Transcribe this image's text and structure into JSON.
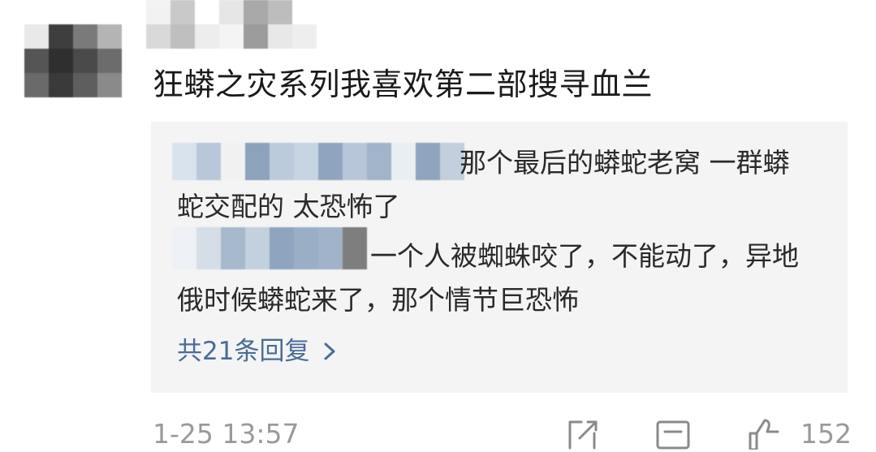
{
  "comment": {
    "text": "狂蟒之灾系列我喜欢第二部搜寻血兰"
  },
  "replies": [
    {
      "line1": "那个最后的蟒蛇老窝  一群蟒",
      "line2": "蛇交配的  太恐怖了"
    },
    {
      "line1": "一个人被蜘蛛咬了，不能动了，异地",
      "line2": "俄时候蟒蛇来了，那个情节巨恐怖"
    }
  ],
  "reply_count_label": "共21条回复",
  "footer": {
    "timestamp": "1-25 13:57",
    "like_count": "152",
    "icons": [
      "share-icon",
      "comment-icon",
      "like-icon"
    ]
  },
  "colors": {
    "link": "#4a6c96",
    "reply_bg": "#f4f4f4",
    "meta": "#9a9a9a"
  },
  "avatar_mosaic": [
    "#e9e9e9",
    "#3e3e3e",
    "#7a7a7a",
    "#b4b4b4",
    "#555555",
    "#2f2f2f",
    "#4a4a4a",
    "#6c6c6c",
    "#6a6a6a",
    "#3a3a3a",
    "#5e5e5e",
    "#8a8a8a"
  ],
  "username_mosaic": [
    "#f2f2f2",
    "#c9c9c9",
    "#ffffff",
    "#e6e6e6",
    "#a8a8a8",
    "#bdbdbd",
    "#ffffff",
    "#ffffff",
    "#d9d9d9",
    "#bfbfbf",
    "#ededed",
    "#f4f4f4",
    "#9c9c9c",
    "#e8e8e8",
    "#eeeeee",
    "#ffffff"
  ],
  "reply1_name_mosaic": [
    "#d9e3ee",
    "#b8c8da",
    "#f1f1f1",
    "#8ca2bd",
    "#bccbdc",
    "#c7d4e2",
    "#8fa5bf",
    "#b7c7d9",
    "#a2b4ca",
    "#e9eef3",
    "#8fa4be",
    "#c3cfdc"
  ],
  "reply2_name_mosaic": [
    "#edf1f5",
    "#d5dde6",
    "#a6b9cd",
    "#c3d0de",
    "#8fa5bf",
    "#9aafc6",
    "#a0b3c9",
    "#7e7e7e"
  ]
}
